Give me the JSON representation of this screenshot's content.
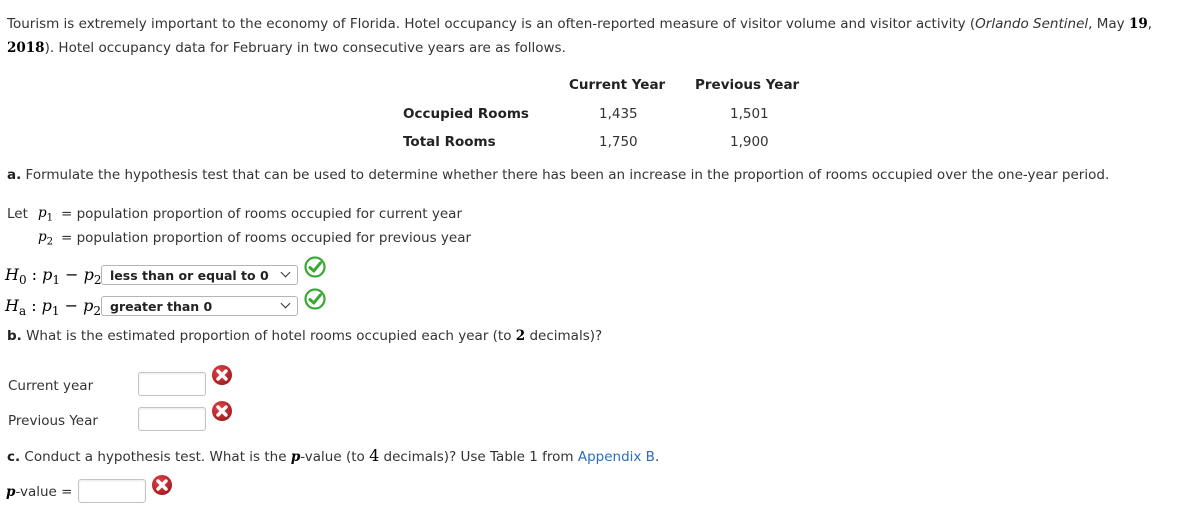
{
  "intro": {
    "text_1": "Tourism is extremely important to the economy of Florida. Hotel occupancy is an often-reported measure of visitor volume and visitor activity (",
    "source": "Orlando Sentinel",
    "text_2": ", May ",
    "day": "19",
    "text_3": ",",
    "year": "2018",
    "text_4": "). Hotel occupancy data for February in two consecutive years are as follows."
  },
  "table": {
    "headers": [
      "Current Year",
      "Previous Year"
    ],
    "rows": [
      {
        "label": "Occupied Rooms",
        "values": [
          "1,435",
          "1,501"
        ]
      },
      {
        "label": "Total Rooms",
        "values": [
          "1,750",
          "1,900"
        ]
      }
    ]
  },
  "part_a": {
    "letter": "a.",
    "question": " Formulate the hypothesis test that can be used to determine whether there has been an increase in the proportion of rooms occupied over the one-year period.",
    "let": "Let",
    "p1_def": "= population proportion of rooms occupied for current year",
    "p2_def": "= population proportion of rooms occupied for previous year",
    "h0_label": "H",
    "h0_sub": "0",
    "ha_label": "H",
    "ha_sub": "a",
    "expr": ": p",
    "h0_selected": "less than or equal to 0",
    "ha_selected": "greater than 0",
    "h0_status": "correct",
    "ha_status": "correct"
  },
  "part_b": {
    "letter": "b.",
    "question_1": " What is the estimated proportion of hotel rooms occupied each year (to ",
    "decimals": "2",
    "question_2": " decimals)?",
    "fields": [
      {
        "label": "Current year",
        "value": "",
        "status": "incorrect"
      },
      {
        "label": "Previous Year",
        "value": "",
        "status": "incorrect"
      }
    ]
  },
  "part_c": {
    "letter": "c.",
    "question_1": " Conduct a hypothesis test. What is the ",
    "p": "p",
    "question_2": "-value (to ",
    "decimals": "4",
    "question_3": " decimals)? Use Table 1 from ",
    "link": "Appendix B",
    "question_4": ".",
    "field_label_p": "p",
    "field_label": "-value =",
    "value": "",
    "status": "incorrect"
  },
  "colors": {
    "correct": "#3aa935",
    "incorrect": "#c0272d",
    "link": "#2a6ebb"
  }
}
